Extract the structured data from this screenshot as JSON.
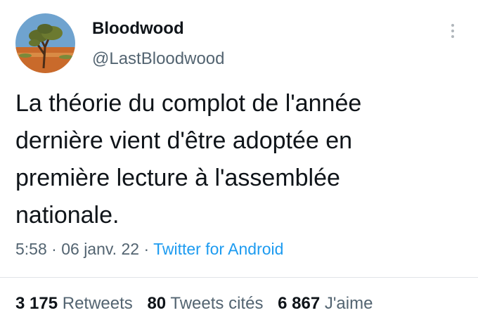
{
  "user": {
    "display_name": "Bloodwood",
    "handle": "@LastBloodwood",
    "avatar_icon": "tree-landscape-avatar"
  },
  "tweet": {
    "text": "La théorie du complot de l'année\ndernière vient d'être adoptée en\npremière lecture à l'assemblée\nnationale.",
    "time": "5:58",
    "separator": "·",
    "date": "06 janv. 22",
    "source": "Twitter for Android"
  },
  "stats": {
    "retweets_count": "3 175",
    "retweets_label": "Retweets",
    "quotes_count": "80",
    "quotes_label": "Tweets cités",
    "likes_count": "6 867",
    "likes_label": "J'aime"
  },
  "colors": {
    "text": "#0f1419",
    "secondary": "#536471",
    "link": "#1d9bf0"
  }
}
